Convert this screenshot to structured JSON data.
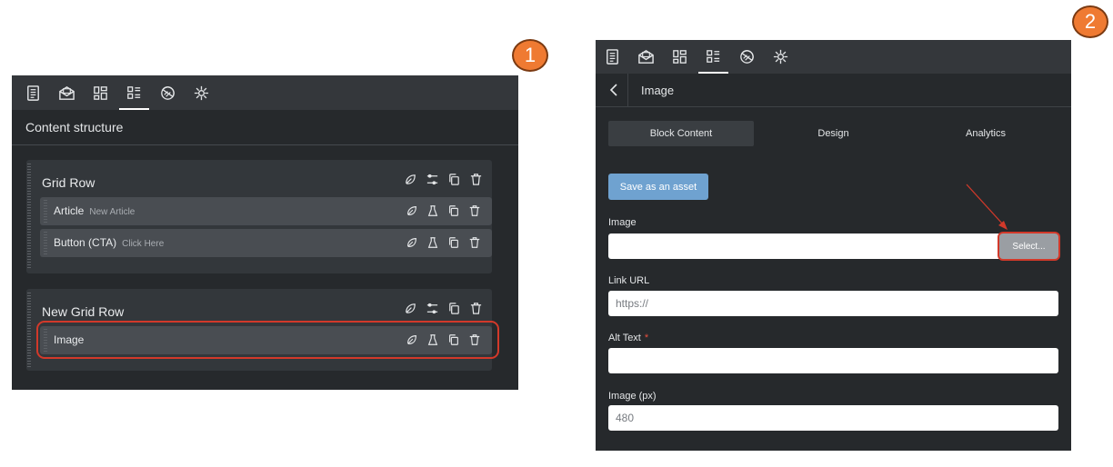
{
  "steps": [
    "1",
    "2"
  ],
  "tab_icons": [
    "page-icon",
    "email-icon",
    "blocks-icon",
    "structure-icon",
    "theme-icon",
    "settings-icon"
  ],
  "panel1": {
    "title": "Content structure",
    "grid_rows": [
      {
        "title": "Grid Row",
        "blocks": [
          {
            "name": "Article",
            "sub": "New Article"
          },
          {
            "name": "Button (CTA)",
            "sub": "Click Here"
          }
        ]
      },
      {
        "title": "New Grid Row",
        "blocks": [
          {
            "name": "Image",
            "sub": ""
          }
        ]
      }
    ]
  },
  "panel2": {
    "title": "Image",
    "tabs": [
      "Block Content",
      "Design",
      "Analytics"
    ],
    "save_asset": "Save as an asset",
    "image_label": "Image",
    "select_label": "Select...",
    "link_label": "Link URL",
    "link_placeholder": "https://",
    "alt_label": "Alt Text",
    "alt_required": "*",
    "width_label": "Image (px)",
    "width_value": "480"
  },
  "colors": {
    "panel_bg": "#26292c",
    "accent_button": "#6fa2d0",
    "highlight": "#d2392a",
    "badge": "#ef7a32"
  }
}
